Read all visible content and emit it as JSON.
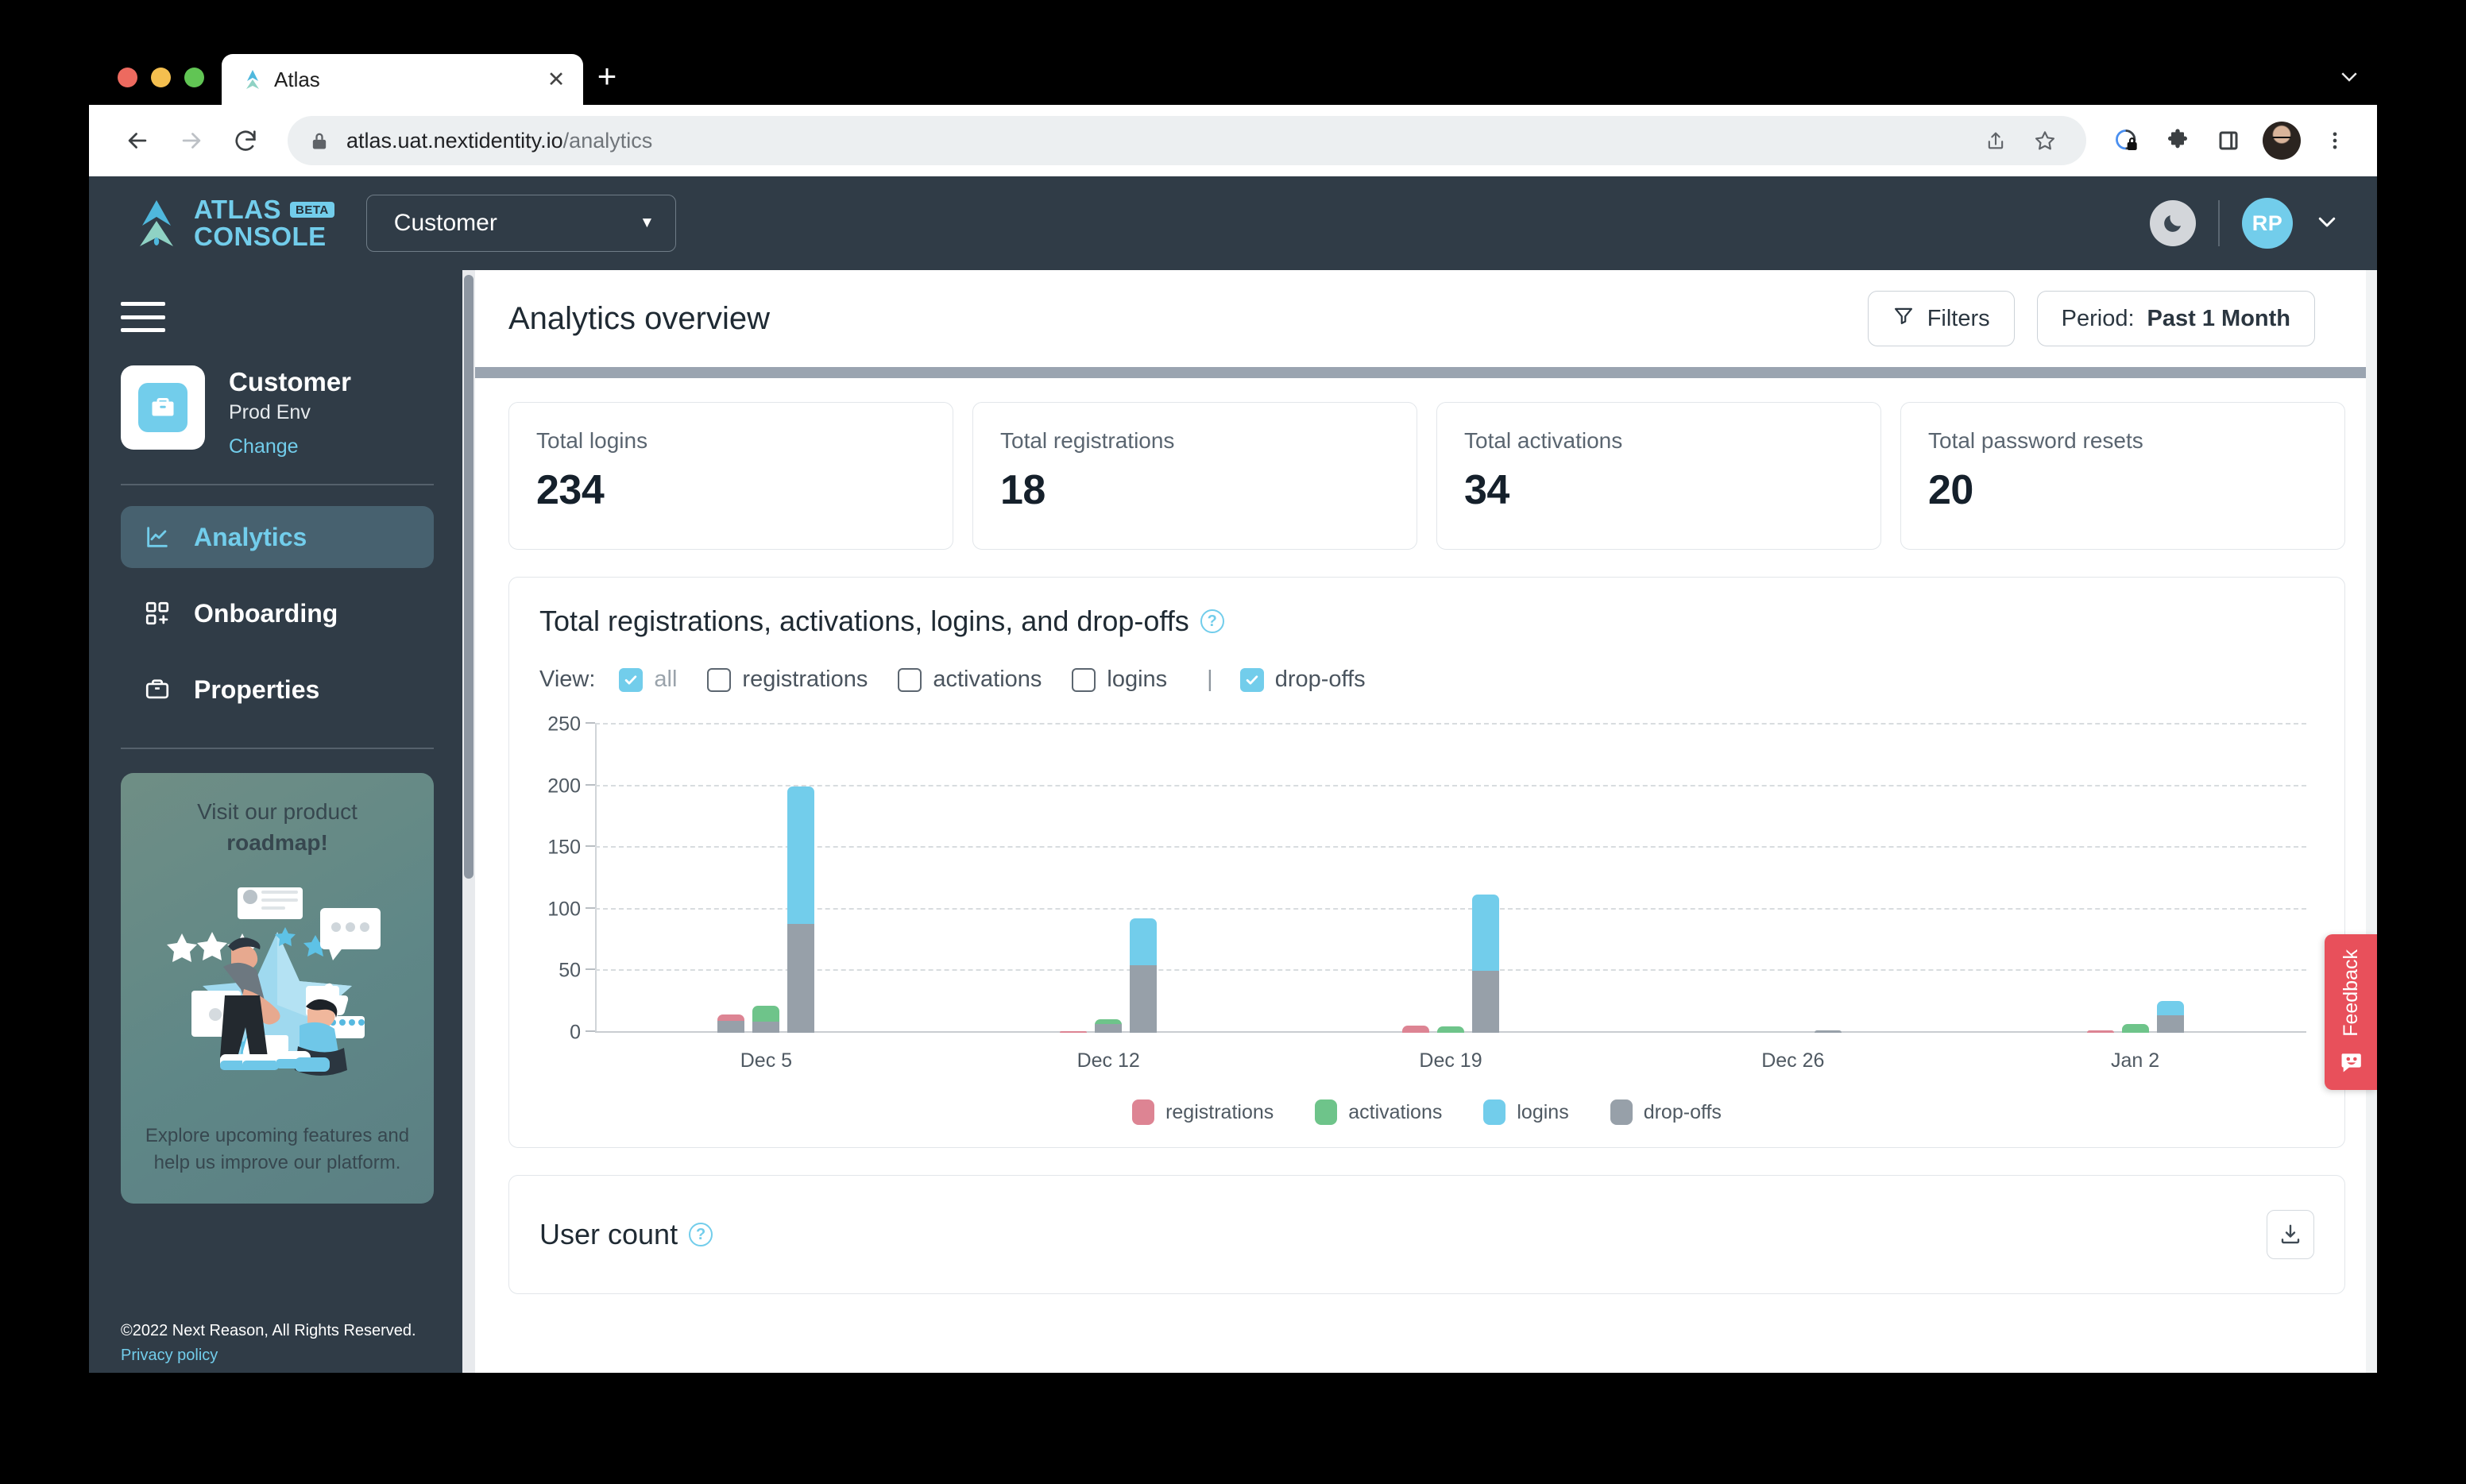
{
  "browser": {
    "tab_title": "Atlas",
    "tab_favicon_icon": "atlas-logo-icon",
    "close_icon": "close-icon",
    "new_tab_icon": "plus-icon",
    "tabstrip_chevron_icon": "chevron-down-icon",
    "back_icon": "back-arrow-icon",
    "forward_icon": "forward-arrow-icon",
    "reload_icon": "reload-icon",
    "lock_icon": "lock-icon",
    "url_domain": "atlas.uat.nextidentity.io",
    "url_path": "/analytics",
    "share_icon": "share-icon",
    "bookmark_icon": "star-icon",
    "privacy_icon": "privacy-shield-icon",
    "extensions_icon": "puzzle-piece-icon",
    "sidepanel_icon": "side-panel-icon",
    "profile_icon": "profile-avatar-icon",
    "menu_icon": "three-dots-menu-icon"
  },
  "header": {
    "brand_word1": "ATLAS",
    "brand_word2": "CONSOLE",
    "brand_badge": "BETA",
    "brand_logo_icon": "atlas-arrow-logo-icon",
    "tenant_selected": "Customer",
    "tenant_caret_icon": "caret-down-icon",
    "dark_mode_icon": "moon-icon",
    "avatar_initials": "RP",
    "avatar_caret_icon": "chevron-down-icon"
  },
  "sidebar": {
    "hamburger_icon": "hamburger-menu-icon",
    "tenant_icon": "briefcase-icon",
    "tenant_name": "Customer",
    "tenant_env": "Prod Env",
    "change_link": "Change",
    "nav": [
      {
        "label": "Analytics",
        "icon": "line-chart-icon",
        "active": true
      },
      {
        "label": "Onboarding",
        "icon": "grid-plus-icon",
        "active": false
      },
      {
        "label": "Properties",
        "icon": "briefcase-icon",
        "active": false
      }
    ],
    "promo_title_line1": "Visit our product",
    "promo_title_line2": "roadmap!",
    "promo_sub": "Explore upcoming features and help us improve our platform.",
    "copyright": "©2022 Next Reason, All Rights Reserved.",
    "privacy_link": "Privacy policy"
  },
  "page": {
    "title": "Analytics overview",
    "filters_button": "Filters",
    "filters_icon": "funnel-icon",
    "period_prefix": "Period:",
    "period_value": "Past 1 Month"
  },
  "kpis": [
    {
      "label": "Total logins",
      "value": "234"
    },
    {
      "label": "Total registrations",
      "value": "18"
    },
    {
      "label": "Total activations",
      "value": "34"
    },
    {
      "label": "Total password resets",
      "value": "20"
    }
  ],
  "chart_card": {
    "title": "Total registrations, activations, logins, and drop-offs",
    "help_icon": "help-circle-icon",
    "help_glyph": "?",
    "view_label": "View:",
    "separator": "|",
    "checkboxes": [
      {
        "label": "all",
        "checked": true,
        "dim": true
      },
      {
        "label": "registrations",
        "checked": false,
        "dim": false
      },
      {
        "label": "activations",
        "checked": false,
        "dim": false
      },
      {
        "label": "logins",
        "checked": false,
        "dim": false
      },
      {
        "label": "drop-offs",
        "checked": true,
        "dim": false
      }
    ]
  },
  "usercount_card": {
    "title": "User count",
    "help_icon": "help-circle-icon",
    "help_glyph": "?",
    "download_icon": "download-icon"
  },
  "feedback": {
    "label": "Feedback",
    "icon": "smiley-chat-icon",
    "color": "#e8505b"
  },
  "colors": {
    "accent": "#72cdeb",
    "header_bg": "#303c47",
    "sidebar_bg": "#303c47",
    "registrations": "#dd8493",
    "activations": "#6ec48a",
    "logins": "#72cdeb",
    "dropoffs": "#97a0a9"
  },
  "chart_data": {
    "type": "bar",
    "title": "Total registrations, activations, logins, and drop-offs",
    "xlabel": "",
    "ylabel": "",
    "categories": [
      "Dec 5",
      "Dec 12",
      "Dec 19",
      "Dec 26",
      "Jan 2"
    ],
    "yticks": [
      0,
      50,
      100,
      150,
      200,
      250
    ],
    "ylim": [
      0,
      250
    ],
    "grid": true,
    "legend_position": "bottom",
    "stacked_note": "each bar is stacked: colored total on top of grey drop-offs portion",
    "series": [
      {
        "name": "registrations",
        "color": "#dd8493",
        "values": [
          15,
          1,
          6,
          0,
          2
        ]
      },
      {
        "name": "activations",
        "color": "#6ec48a",
        "values": [
          22,
          11,
          5,
          0,
          7
        ]
      },
      {
        "name": "logins",
        "color": "#72cdeb",
        "values": [
          200,
          93,
          112,
          0,
          26
        ]
      },
      {
        "name": "drop-offs",
        "color": "#97a0a9",
        "values_by_bar": {
          "registrations": [
            10,
            0,
            0,
            0,
            0
          ],
          "activations": [
            9,
            7,
            0,
            0,
            0
          ],
          "logins": [
            88,
            55,
            50,
            2,
            14
          ]
        }
      }
    ],
    "legend": [
      "registrations",
      "activations",
      "logins",
      "drop-offs"
    ]
  }
}
